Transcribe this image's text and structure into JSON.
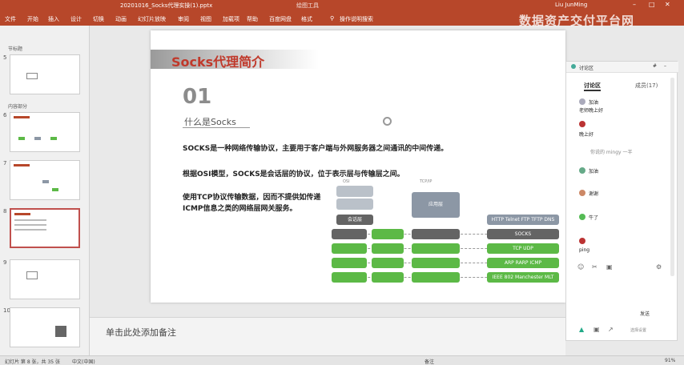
{
  "window": {
    "filename": "20201016_Socks代理实操(1).pptx",
    "app": "PowerPoint",
    "context_tab": "绘图工具",
    "user": "Liu JunMing"
  },
  "ribbon_tabs": [
    "文件",
    "开始",
    "插入",
    "设计",
    "切换",
    "动画",
    "幻灯片放映",
    "审阅",
    "视图",
    "加载项",
    "帮助",
    "百度网盘",
    "格式",
    "操作说明搜索"
  ],
  "watermark": "数据资产交付平台网",
  "thumbnails": {
    "section1": "节标题",
    "section2": "内容部分",
    "slide_numbers": [
      "5",
      "6",
      "7",
      "8",
      "9",
      "10"
    ]
  },
  "slide": {
    "title": "Socks代理简介",
    "number": "01",
    "subtitle": "什么是Socks",
    "para1": "SOCKS是一种网络传输协议，主要用于客户端与外网服务器之间通讯的中间传递。",
    "para2": "根据OSI模型，SOCKS是会话层的协议，位于表示层与传输层之间。",
    "para3": "使用TCP协议传输数据，因而不提供如传递 ICMP信息之类的网络层网关服务。",
    "diagram": {
      "stack_top": "应用层",
      "session": "会话层",
      "protocols_app": "HTTP Telnet FTP TFTP DNS",
      "rows_right": [
        "SOCKS",
        "TCP UDP",
        "ARP RARP ICMP",
        "IEEE 802 Manchester MLT"
      ]
    }
  },
  "notes": {
    "placeholder": "单击此处添加备注"
  },
  "chat": {
    "header": "讨论区",
    "tabs": [
      "讨论区",
      "成员(17)"
    ],
    "messages": [
      {
        "name": "",
        "text": "加油"
      },
      {
        "name": "",
        "text": "老师晚上好"
      },
      {
        "name": "",
        "text": "晚上好"
      },
      {
        "name": "",
        "text": "你说的 mingy 一半"
      },
      {
        "name": "",
        "text": "加油"
      },
      {
        "name": "",
        "text": "谢谢"
      },
      {
        "name": "",
        "text": "牛了"
      },
      {
        "name": "",
        "text": "ping"
      }
    ],
    "send_button": "发送",
    "footer_link": "选择设置"
  },
  "status": {
    "slide_info": "幻灯片 第 8 张，共 35 张",
    "language": "中文(中国)",
    "notes_btn": "备注",
    "zoom": "91%"
  }
}
